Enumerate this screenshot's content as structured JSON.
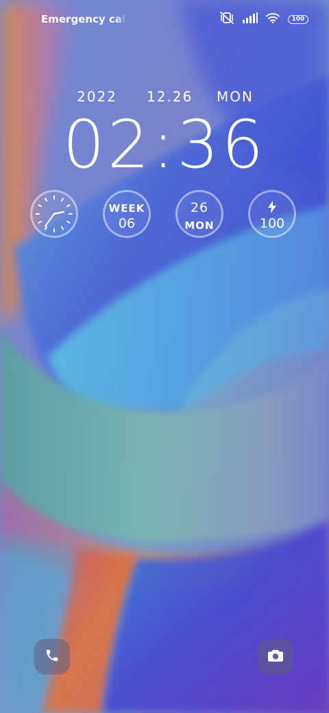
{
  "status_bar": {
    "carrier_text": "Emergency calls only",
    "battery_level": "100",
    "icons": [
      "vibrate-off-icon",
      "signal-icon",
      "wifi-icon",
      "battery-icon"
    ]
  },
  "lock_screen": {
    "date": {
      "year": "2022",
      "month_day": "12.26",
      "weekday": "MON"
    },
    "time": "02:36",
    "widgets": {
      "analog_clock": {
        "hour": 2,
        "minute": 36
      },
      "week": {
        "label": "WEEK",
        "value": "06"
      },
      "day": {
        "number": "26",
        "weekday": "MON"
      },
      "battery": {
        "icon": "bolt-icon",
        "value": "100"
      }
    }
  },
  "shortcuts": {
    "left": {
      "icon": "phone-icon"
    },
    "right": {
      "icon": "camera-icon"
    }
  },
  "colors": {
    "wallpaper_blue": "#4a6fe0",
    "wallpaper_orange": "#e8844a",
    "wallpaper_teal": "#6cc6c8",
    "wallpaper_purple": "#6a4ac8"
  }
}
